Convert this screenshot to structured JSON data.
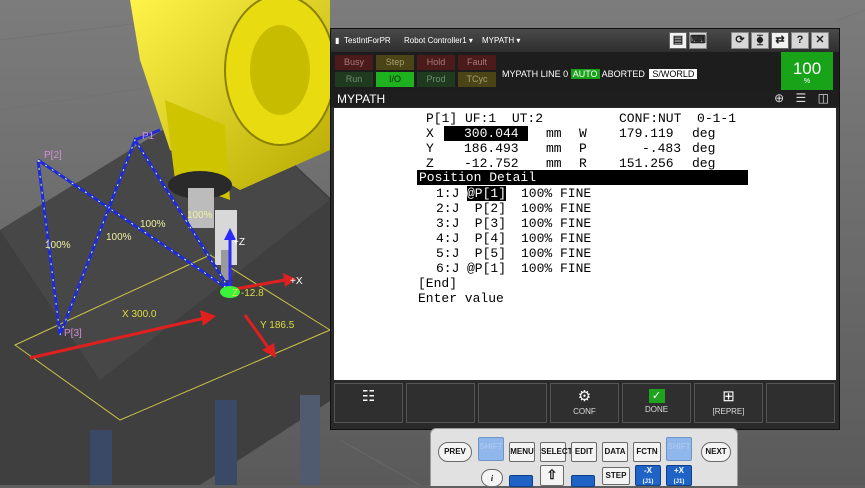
{
  "scene": {
    "points": [
      "P[2]",
      "P[3]",
      "P1"
    ],
    "speeds": [
      "100%",
      "100%",
      "100%",
      "100%"
    ],
    "axis_labels": {
      "x_axis": "+X",
      "z_axis": "+Z"
    },
    "readouts": {
      "x": "X 300.0",
      "y": "Y 186.5",
      "z": "Z -12.8"
    },
    "colors": {
      "robot": "#f2e600",
      "path": "#1f2bd8",
      "arrow": "#e01f1f",
      "table": "#4a4a4a"
    }
  },
  "titlebar": {
    "app": "TestIntForPR",
    "controller": "Robot Controller1 ▾",
    "program": "MYPATH ▾",
    "buttons": [
      "▤",
      "⌨",
      "⟳",
      "⧳",
      "⇄",
      "?",
      "✕"
    ]
  },
  "status": {
    "leds": [
      "Busy",
      "Step",
      "Hold",
      "Fault",
      "Run",
      "I/O",
      "Prod",
      "TCyc"
    ],
    "line_text": "MYPATH LINE 0",
    "mode": "AUTO",
    "state": "ABORTED",
    "frame": "S/WORLD",
    "override_value": "100",
    "override_unit": "%"
  },
  "screen": {
    "title": "MYPATH",
    "icons": "⊕ ☰ ◫"
  },
  "position": {
    "header": "P[1] UF:1  UT:2",
    "conf": "CONF:NUT  0-1-1",
    "rows": [
      {
        "axis": "X",
        "value": "300.044",
        "unit": "mm",
        "raxis": "W",
        "rvalue": "179.119",
        "runit": "deg"
      },
      {
        "axis": "Y",
        "value": "186.493",
        "unit": "mm",
        "raxis": "P",
        "rvalue": "-.483",
        "runit": "deg"
      },
      {
        "axis": "Z",
        "value": "-12.752",
        "unit": "mm",
        "raxis": "R",
        "rvalue": "151.256",
        "runit": "deg"
      }
    ],
    "detail_title": "Position Detail"
  },
  "program_lines": [
    {
      "num": "1:J",
      "pt": "@P[1]",
      "rest": "100% FINE"
    },
    {
      "num": "2:J",
      "pt": " P[2]",
      "rest": "100% FINE"
    },
    {
      "num": "3:J",
      "pt": " P[3]",
      "rest": "100% FINE"
    },
    {
      "num": "4:J",
      "pt": " P[4]",
      "rest": "100% FINE"
    },
    {
      "num": "5:J",
      "pt": " P[5]",
      "rest": "100% FINE"
    },
    {
      "num": "6:J",
      "pt": "@P[1]",
      "rest": "100% FINE"
    }
  ],
  "end_line": "[End]",
  "prompt": "Enter value",
  "function_keys": [
    {
      "icon": "☷",
      "label": ""
    },
    {
      "icon": "",
      "label": ""
    },
    {
      "icon": "",
      "label": ""
    },
    {
      "icon": "⚙",
      "label": "CONF"
    },
    {
      "icon": "✓",
      "label": "DONE"
    },
    {
      "icon": "⊞",
      "label": "[REPRE]"
    },
    {
      "icon": "",
      "label": ""
    }
  ],
  "keypad": {
    "prev": "PREV",
    "shift_l": "SHIFT",
    "menu": "MENU",
    "select": "SELECT",
    "edit": "EDIT",
    "data": "DATA",
    "fctn": "FCTN",
    "shift_r": "SHIFT",
    "next": "NEXT",
    "info": "i",
    "up": "⇧",
    "step": "STEP",
    "minus_x": "-X",
    "minus_x_sub": "(J1)",
    "plus_x": "+X",
    "plus_x_sub": "(J1)"
  }
}
